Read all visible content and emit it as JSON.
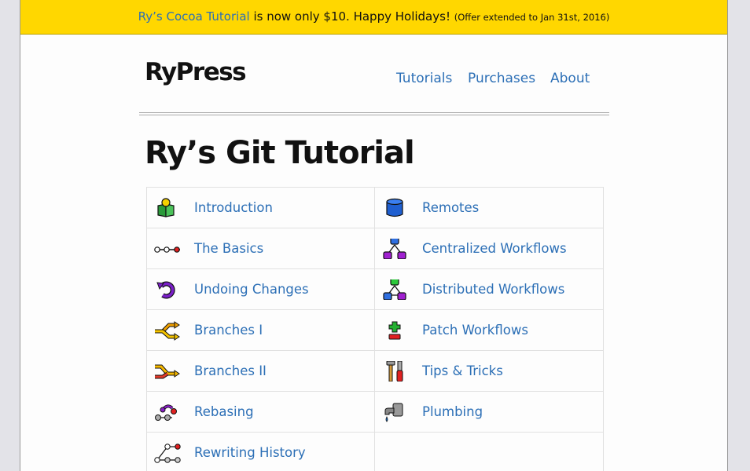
{
  "banner": {
    "link": "Ry’s Cocoa Tutorial",
    "text": " is now only $10. Happy Holidays! ",
    "note": "(Offer extended to Jan 31st, 2016)",
    "color": "#ffd700"
  },
  "header": {
    "logo": "RyPress",
    "nav": [
      "Tutorials",
      "Purchases",
      "About"
    ]
  },
  "page_title": "Ry’s Git Tutorial",
  "colors": {
    "link": "#2c6fb6"
  },
  "chapters_left": [
    {
      "label": "Introduction",
      "icon": "book-icon"
    },
    {
      "label": "The Basics",
      "icon": "commit-chain-icon"
    },
    {
      "label": "Undoing Changes",
      "icon": "undo-arrow-icon"
    },
    {
      "label": "Branches I",
      "icon": "branch-arrows-icon"
    },
    {
      "label": "Branches II",
      "icon": "merge-arrows-icon"
    },
    {
      "label": "Rebasing",
      "icon": "rebase-icon"
    },
    {
      "label": "Rewriting History",
      "icon": "history-graph-icon"
    }
  ],
  "chapters_right": [
    {
      "label": "Remotes",
      "icon": "database-icon"
    },
    {
      "label": "Centralized Workflows",
      "icon": "centralized-tree-icon"
    },
    {
      "label": "Distributed Workflows",
      "icon": "distributed-tree-icon"
    },
    {
      "label": "Patch Workflows",
      "icon": "plus-minus-icon"
    },
    {
      "label": "Tips & Tricks",
      "icon": "tools-icon"
    },
    {
      "label": "Plumbing",
      "icon": "faucet-icon"
    }
  ]
}
